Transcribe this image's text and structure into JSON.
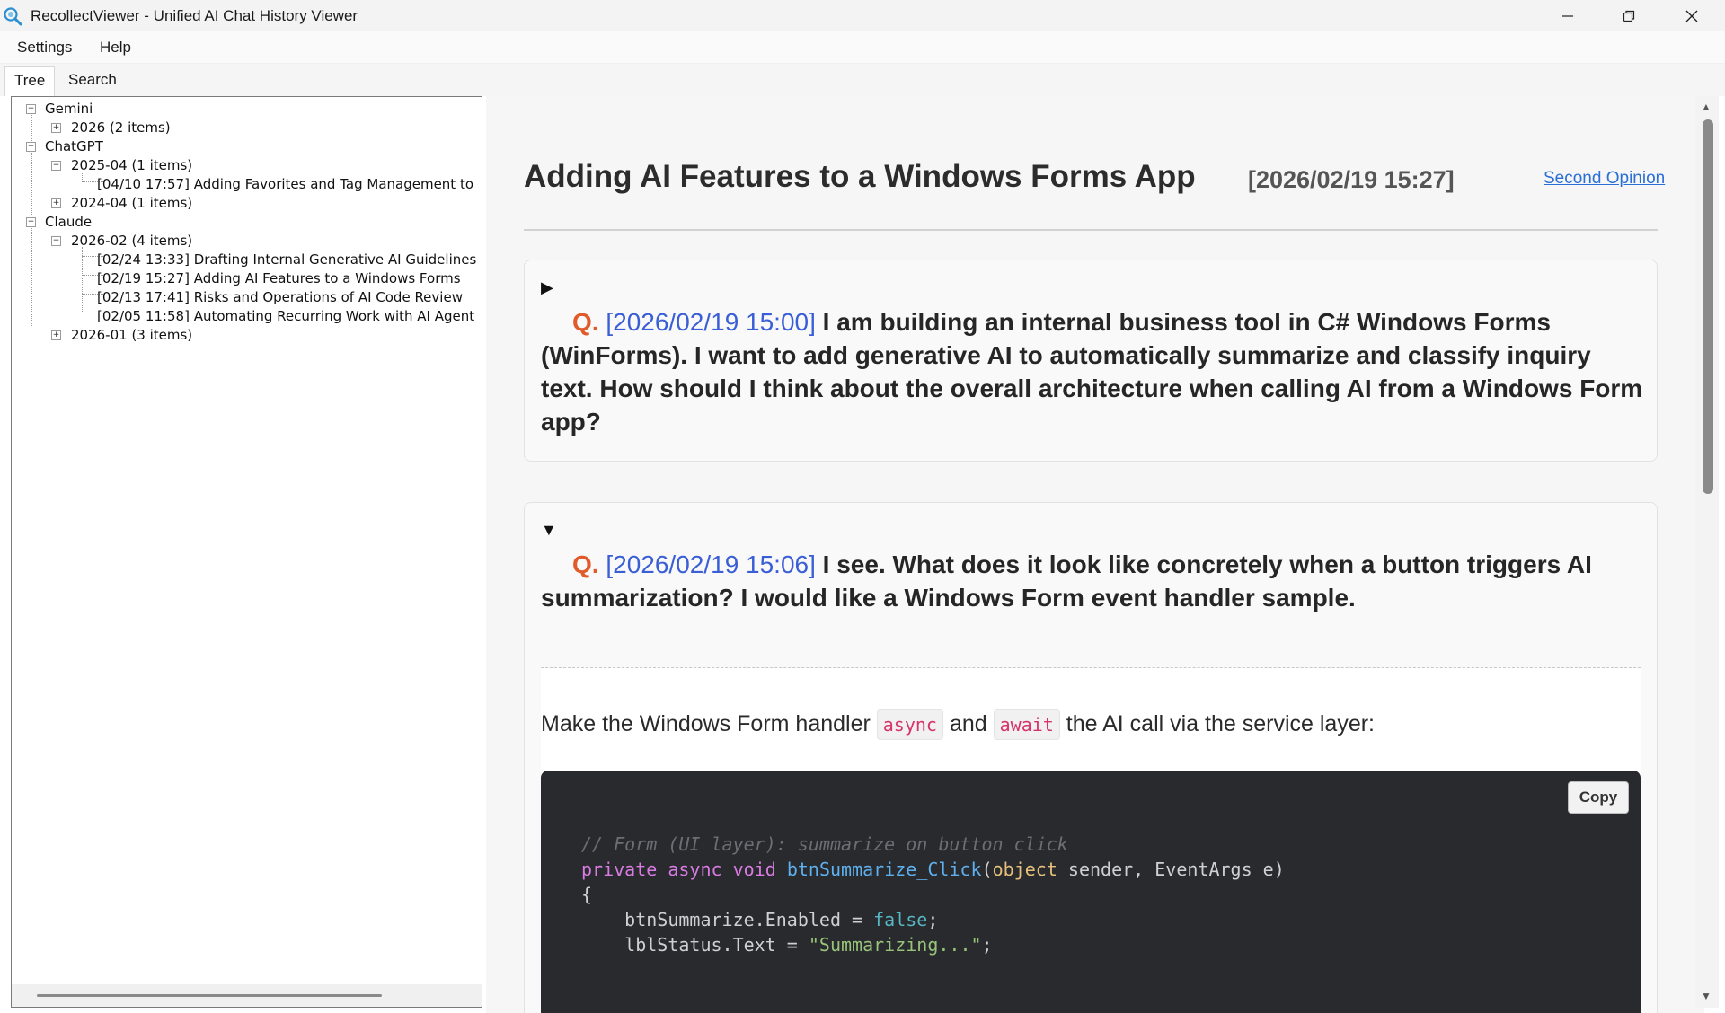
{
  "window": {
    "title": "RecollectViewer - Unified AI Chat History Viewer"
  },
  "menu": {
    "settings": "Settings",
    "help": "Help"
  },
  "tabs": {
    "tree": "Tree",
    "search": "Search"
  },
  "tree": {
    "gemini": "Gemini",
    "gemini_2026": "2026 (2 items)",
    "chatgpt": "ChatGPT",
    "chatgpt_2025_04": "2025-04 (1 items)",
    "chatgpt_2025_04_item": "[04/10 17:57] Adding Favorites and Tag Management to",
    "chatgpt_2024_04": "2024-04 (1 items)",
    "claude": "Claude",
    "claude_2026_02": "2026-02 (4 items)",
    "claude_item_1": "[02/24 13:33] Drafting Internal Generative AI Guidelines",
    "claude_item_2": "[02/19 15:27] Adding AI Features to a Windows Forms",
    "claude_item_3": "[02/13 17:41] Risks and Operations of AI Code Review",
    "claude_item_4": "[02/05 11:58] Automating Recurring Work with AI Agent",
    "claude_2026_01": "2026-01 (3 items)"
  },
  "conversation": {
    "title": "Adding AI Features to a Windows Forms App",
    "date": "[2026/02/19 15:27]",
    "second_opinion": "Second Opinion",
    "q1": {
      "label": "Q.",
      "date": "[2026/02/19 15:00]",
      "text": "I am building an internal business tool in C# Windows Forms (WinForms). I want to add generative AI to automatically summarize and classify inquiry text. How should I think about the overall architecture when calling AI from a Windows Form app?"
    },
    "q2": {
      "label": "Q.",
      "date": "[2026/02/19 15:06]",
      "text": "I see. What does it look like concretely when a button triggers AI summarization? I would like a Windows Form event handler sample."
    },
    "answer": {
      "prefix": "Make the Windows Form handler",
      "code1": "async",
      "middle": "and",
      "code2": "await",
      "suffix": "the AI call via the service layer:"
    },
    "code": {
      "copy_label": "Copy",
      "line1": "// Form (UI layer): summarize on button click",
      "line2_kw1": "private",
      "line2_kw2": "async",
      "line2_kw3": "void",
      "line2_fn": "btnSummarize_Click",
      "line2_open": "(",
      "line2_type": "object",
      "line2_rest": " sender, EventArgs e)",
      "line3": "{",
      "line4_a": "    btnSummarize.Enabled = ",
      "line4_b": "false",
      "line4_c": ";",
      "line5_a": "    lblStatus.Text = ",
      "line5_b": "\"Summarizing...\"",
      "line5_c": ";"
    }
  },
  "colors": {
    "question_label": "#e05a2a",
    "timestamp": "#3a5ed6",
    "link": "#2a6fd6",
    "inline_code": "#d6336c",
    "code_bg": "#282a2e"
  },
  "icons": {
    "app": "magnifier-icon",
    "collapsed": "plus-box",
    "expanded": "minus-box"
  }
}
